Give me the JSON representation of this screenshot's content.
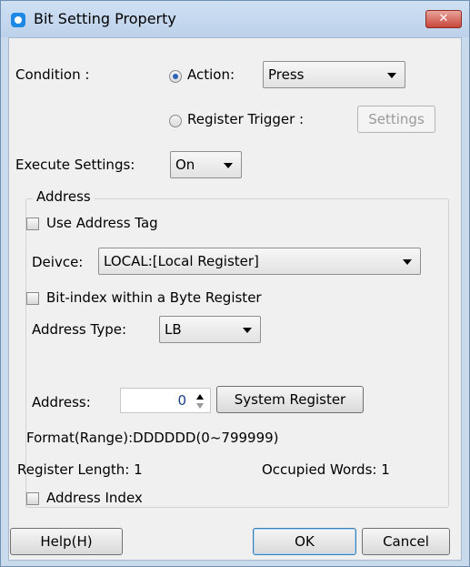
{
  "window": {
    "title": "Bit Setting Property",
    "close_label": "✕"
  },
  "condition": {
    "label": "Condition :",
    "action_label": "Action:",
    "action_value": "Press",
    "register_trigger_label": "Register Trigger :",
    "settings_button": "Settings"
  },
  "execute": {
    "label": "Execute Settings:",
    "value": "On"
  },
  "address": {
    "group_title": "Address",
    "use_tag_label": "Use Address Tag",
    "device_label": "Deivce:",
    "device_value": "LOCAL:[Local Register]",
    "bit_index_label": "Bit-index within a Byte Register",
    "type_label": "Address Type:",
    "type_value": "LB",
    "address_label": "Address:",
    "address_value": "0",
    "system_register_button": "System Register",
    "format_text": "Format(Range):DDDDDD(0~799999)",
    "register_length": "Register Length: 1",
    "occupied_words": "Occupied Words: 1",
    "address_index_label": "Address Index"
  },
  "footer": {
    "help": "Help(H)",
    "ok": "OK",
    "cancel": "Cancel"
  }
}
